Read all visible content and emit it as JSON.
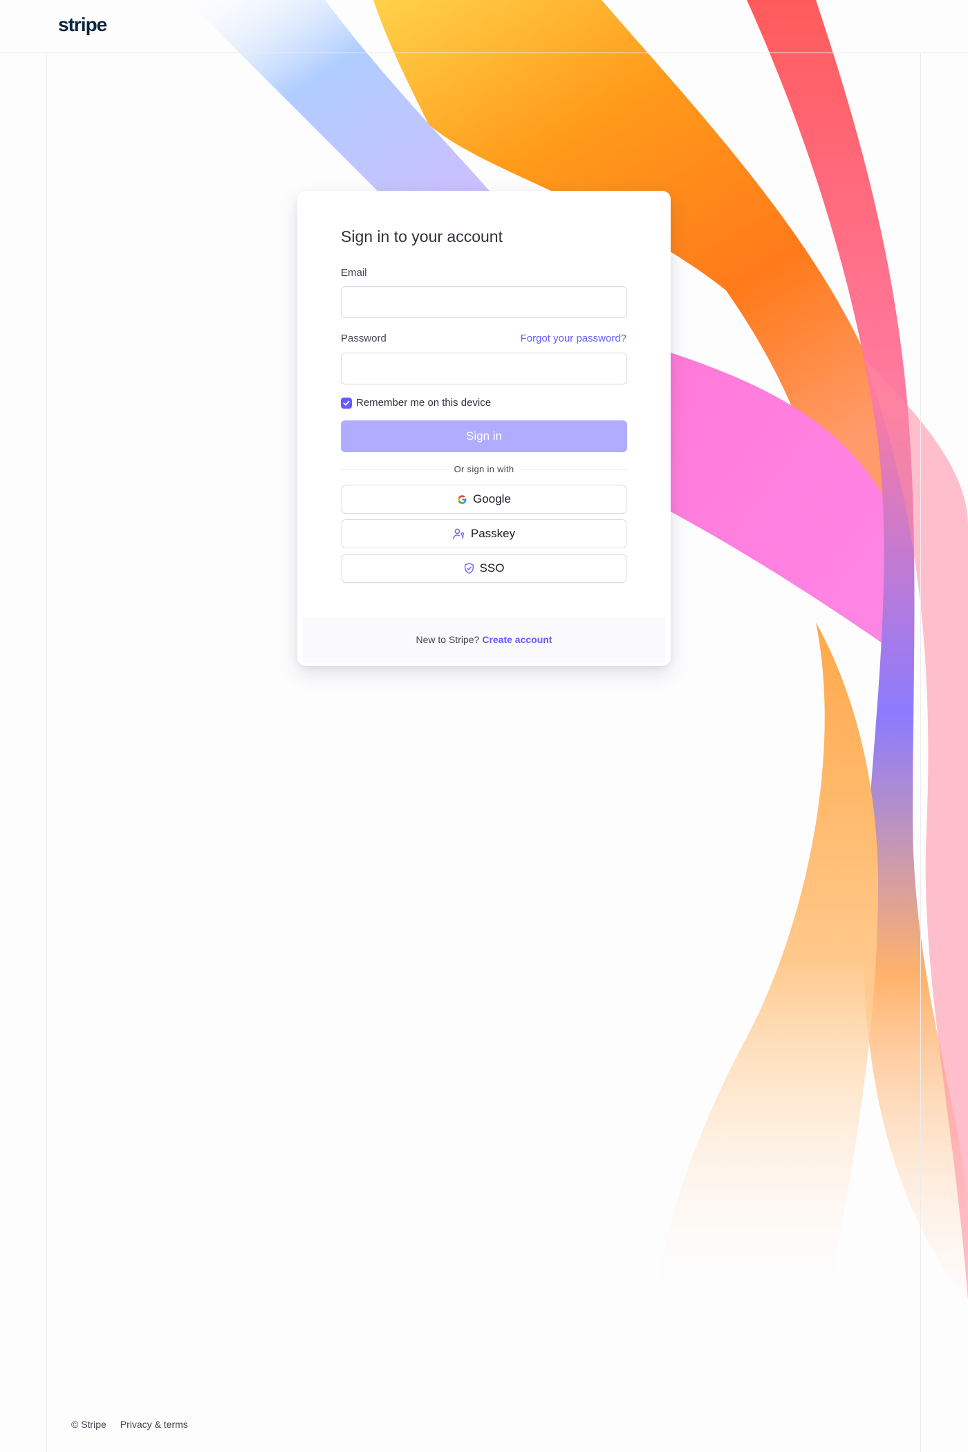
{
  "header": {
    "logo_text": "stripe"
  },
  "signin": {
    "title": "Sign in to your account",
    "email_label": "Email",
    "email_value": "",
    "password_label": "Password",
    "password_value": "",
    "forgot_link": "Forgot your password?",
    "remember_label": "Remember me on this device",
    "remember_checked": true,
    "submit_label": "Sign in",
    "divider_text": "Or sign in with",
    "alt_options": [
      {
        "label": "Google",
        "icon": "google-icon"
      },
      {
        "label": "Passkey",
        "icon": "passkey-icon"
      },
      {
        "label": "SSO",
        "icon": "shield-check-icon"
      }
    ],
    "footer_text": "New to Stripe?",
    "footer_link": "Create account"
  },
  "footer": {
    "copyright": "© Stripe",
    "privacy_link": "Privacy & terms"
  },
  "colors": {
    "accent": "#635bff",
    "accent_disabled": "#b0acff",
    "brand_text": "#0a2540"
  }
}
